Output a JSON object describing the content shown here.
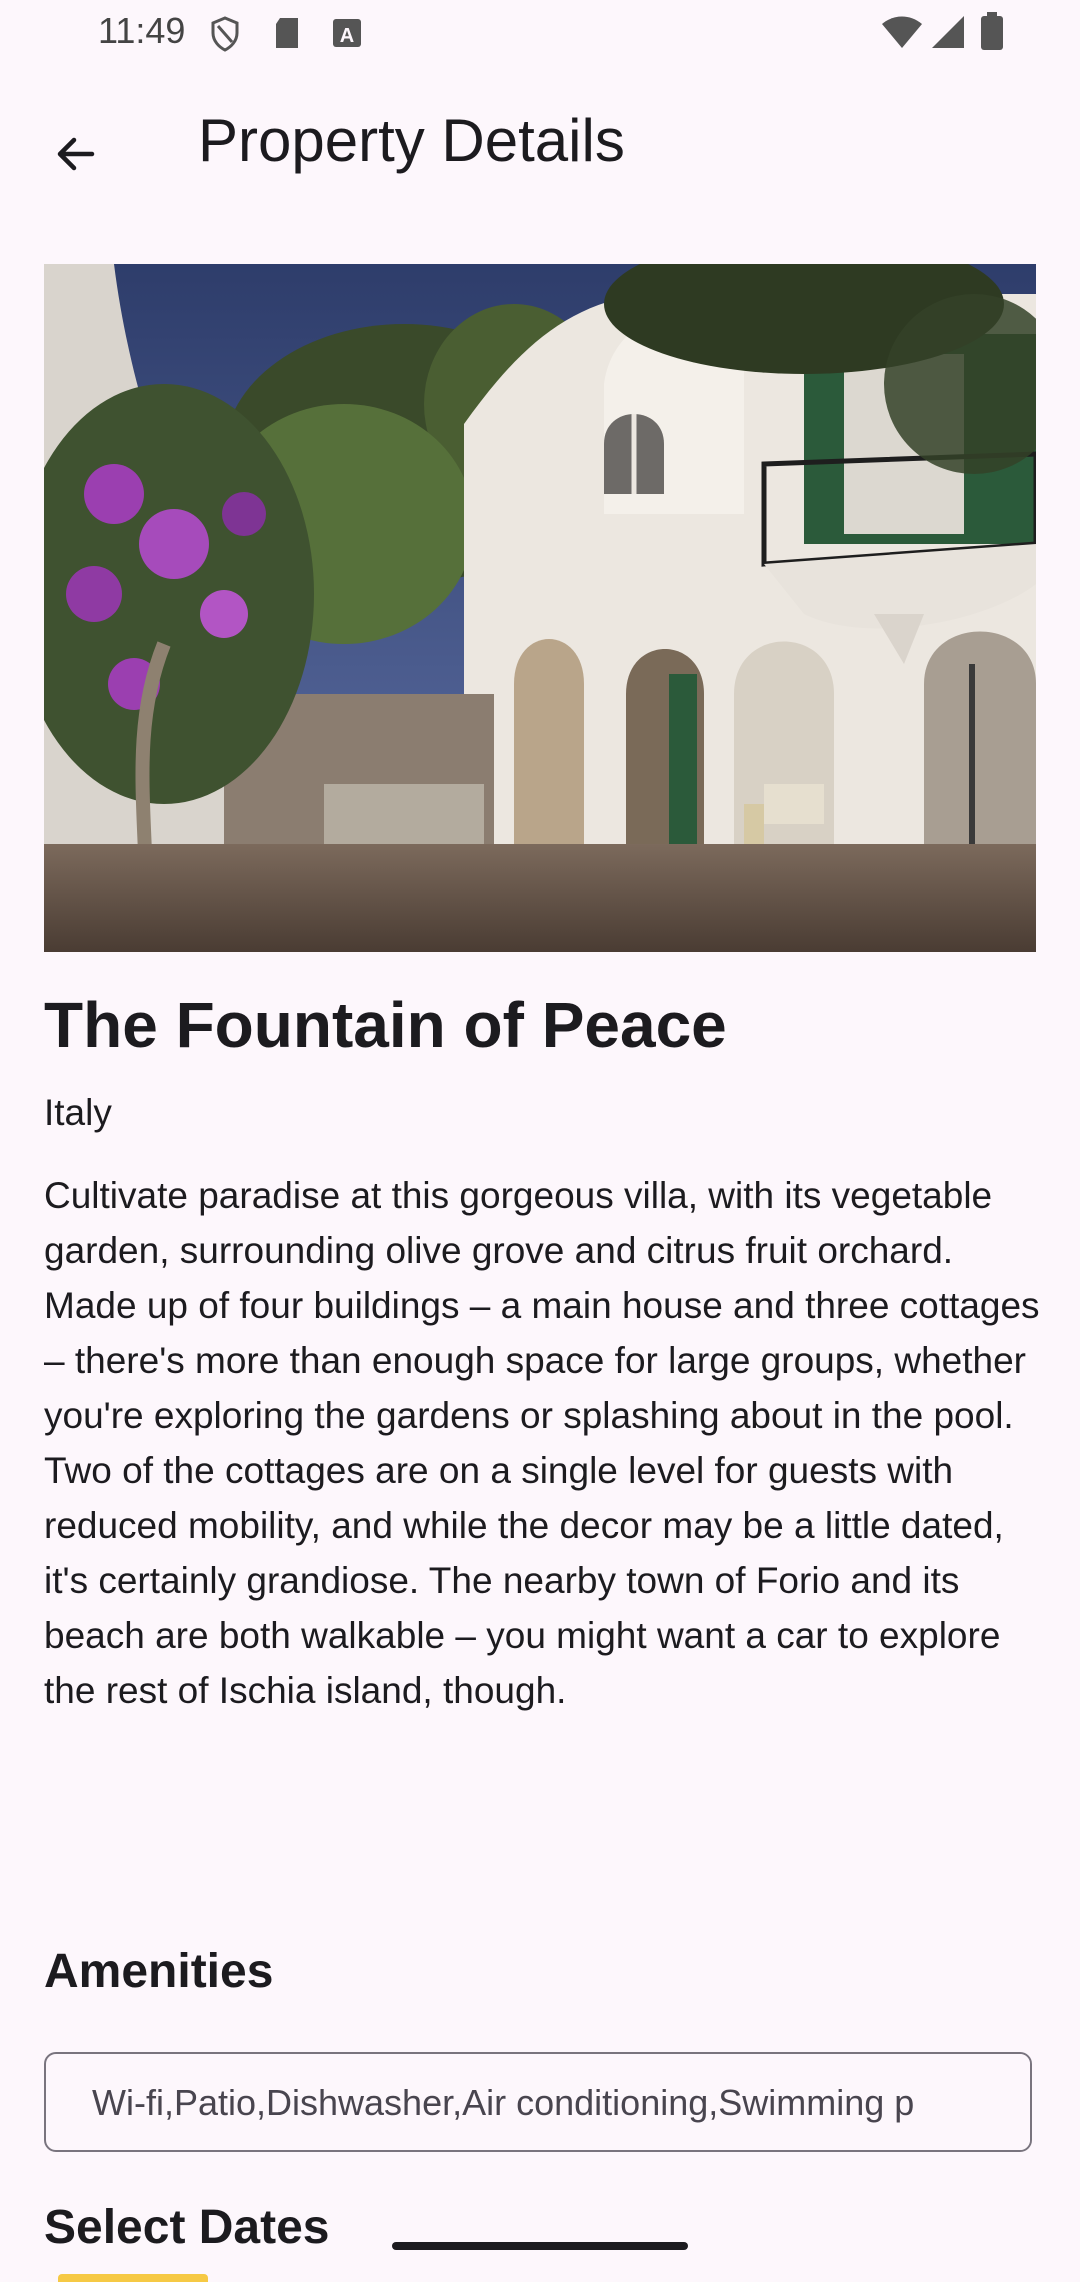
{
  "status_bar": {
    "time": "11:49",
    "left_icons": [
      "shield-icon",
      "sd-card-icon",
      "a-badge-icon"
    ],
    "right_icons": [
      "wifi-icon",
      "cell-signal-icon",
      "battery-icon"
    ]
  },
  "app_bar": {
    "title": "Property Details",
    "back_icon": "arrow-back-icon"
  },
  "property": {
    "name": "The Fountain of Peace",
    "country": "Italy",
    "description": "Cultivate paradise at this gorgeous villa, with its vegetable garden, surrounding olive grove and citrus fruit orchard. Made up of four buildings – a main house and three cottages – there's more than enough space for large groups, whether you're exploring the gardens or splashing about in the pool. Two of the cottages are on a single level for guests with reduced mobility, and while the decor may be a little dated, it's certainly grandiose. The nearby town of Forio and its beach are both walkable – you might want a car to explore the rest of Ischia island, though."
  },
  "amenities": {
    "heading": "Amenities",
    "value": "Wi-fi,Patio,Dishwasher,Air conditioning,Swimming p"
  },
  "dates": {
    "heading": "Select Dates"
  },
  "colors": {
    "background": "#fdf7fc",
    "text": "#1c1b1f",
    "field_border": "#79747e",
    "chip_accent": "#f6c945"
  }
}
